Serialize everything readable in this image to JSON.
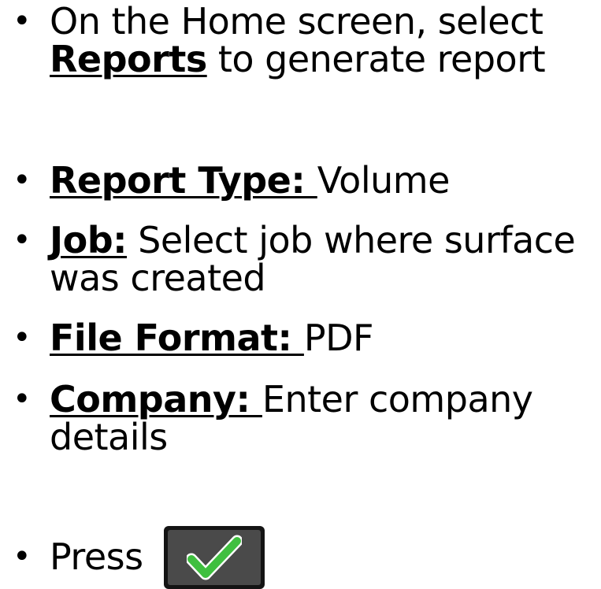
{
  "bullets": [
    {
      "lines": [
        {
          "pre": "",
          "keyword": "",
          "text": "On the Home screen, select"
        },
        {
          "pre": "",
          "keyword": "Reports",
          "text": " to generate report"
        }
      ]
    },
    {
      "lines": [
        {
          "keyword": "Report Type: ",
          "text": "Volume"
        }
      ]
    },
    {
      "lines": [
        {
          "keyword": "Job:",
          "text": " Select job where surface"
        },
        {
          "keyword": "",
          "text": "was created"
        }
      ]
    },
    {
      "lines": [
        {
          "keyword": "File Format: ",
          "text": "PDF"
        }
      ]
    },
    {
      "lines": [
        {
          "keyword": "Company: ",
          "text": "Enter company"
        },
        {
          "keyword": "",
          "text": "details"
        }
      ]
    },
    {
      "lines": [
        {
          "keyword": "",
          "text": "Press"
        }
      ]
    }
  ],
  "bullet_symbol": "•",
  "confirm_button": {
    "icon": "checkmark-icon",
    "check_color": "#3fbf3f",
    "check_outline": "#ffffff",
    "frame_color": "#141414",
    "face_color": "#4a4a4a"
  }
}
